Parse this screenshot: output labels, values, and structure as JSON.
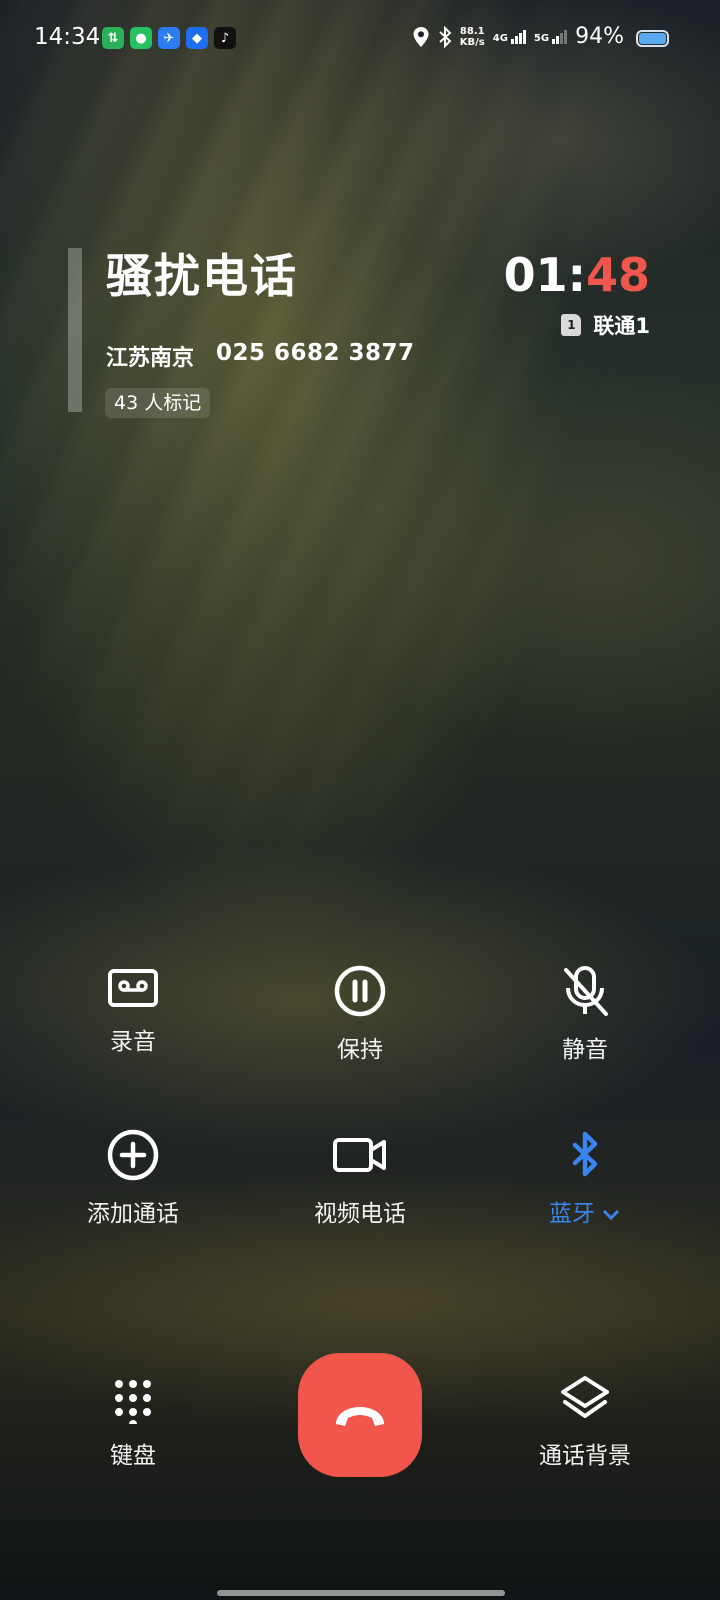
{
  "status_bar": {
    "time": "14:34",
    "net_speed_value": "88.1",
    "net_speed_unit": "KB/s",
    "sim1_network": "4G",
    "sim2_network": "5G",
    "battery_percent": "94%",
    "notification_icons": [
      "data-transfer-icon",
      "wechat-icon",
      "airplane-app-icon",
      "dingtalk-icon",
      "tiktok-icon"
    ]
  },
  "call": {
    "caller_label": "骚扰电话",
    "location": "江苏南京",
    "number": "025 6682 3877",
    "marked_count": "43 人标记",
    "timer_minutes": "01:",
    "timer_seconds": "48",
    "sim_slot": "1",
    "carrier": "联通1"
  },
  "controls": {
    "record": "录音",
    "hold": "保持",
    "mute": "静音",
    "add_call": "添加通话",
    "video_call": "视频电话",
    "audio_route": "蓝牙"
  },
  "bottom": {
    "keypad": "键盘",
    "call_background": "通话背景"
  },
  "colors": {
    "end_call": "#f0564c",
    "timer_seconds": "#f0564c",
    "bluetooth_active": "#3a84f0"
  }
}
